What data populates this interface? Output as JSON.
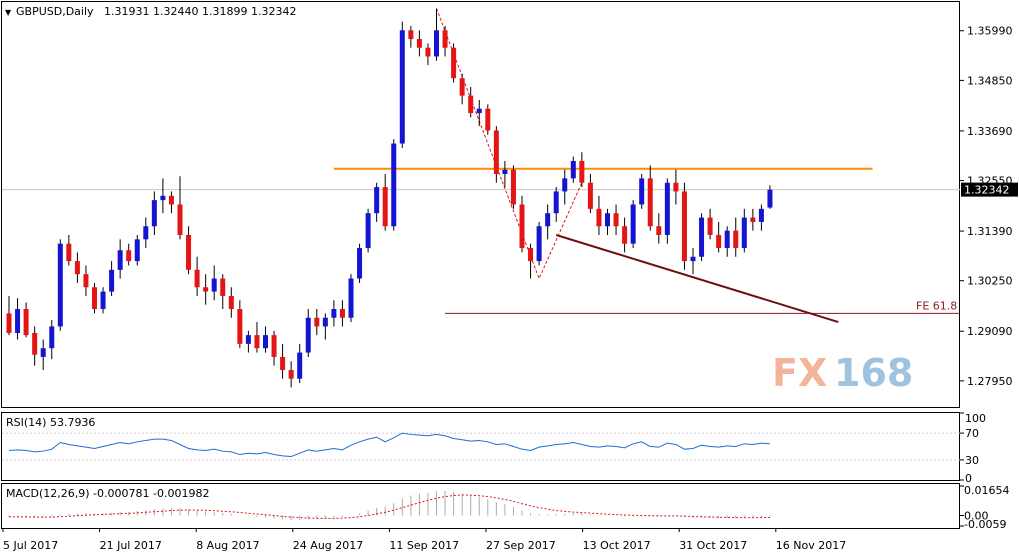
{
  "header": {
    "symbol_label": "GBPUSD,Daily",
    "ohlc_label": "1.31931 1.32440 1.31899 1.32342"
  },
  "watermark": {
    "fx": "FX",
    "num": "168",
    "fx_color": "#f3b59a",
    "num_color": "#9fc3df"
  },
  "chart_data": [
    {
      "type": "candlestick",
      "title": "",
      "y_ticks": [
        1.2795,
        1.2909,
        1.3025,
        1.3139,
        1.3255,
        1.3369,
        1.3485,
        1.3599
      ],
      "y_tick_labels": [
        "1.27950",
        "1.29090",
        "1.30250",
        "1.31390",
        "1.32550",
        "1.33690",
        "1.34850",
        "1.35990"
      ],
      "ylim": [
        1.2735,
        1.3665
      ],
      "current_price": 1.32342,
      "current_price_label": "1.32342",
      "x_labels": [
        "5 Jul 2017",
        "21 Jul 2017",
        "8 Aug 2017",
        "24 Aug 2017",
        "11 Sep 2017",
        "27 Sep 2017",
        "13 Oct 2017",
        "31 Oct 2017",
        "16 Nov 2017"
      ],
      "up_color": "#1414d2",
      "down_color": "#e51515",
      "candles_ohlc": [
        [
          1.295,
          1.299,
          1.29,
          1.2905
        ],
        [
          1.2905,
          1.2985,
          1.289,
          1.296
        ],
        [
          1.296,
          1.2975,
          1.2895,
          1.29
        ],
        [
          1.2905,
          1.292,
          1.283,
          1.2855
        ],
        [
          1.285,
          1.289,
          1.282,
          1.287
        ],
        [
          1.287,
          1.2935,
          1.2845,
          1.292
        ],
        [
          1.292,
          1.312,
          1.291,
          1.311
        ],
        [
          1.311,
          1.313,
          1.306,
          1.307
        ],
        [
          1.307,
          1.309,
          1.302,
          1.304
        ],
        [
          1.304,
          1.306,
          1.299,
          1.301
        ],
        [
          1.301,
          1.302,
          1.295,
          1.296
        ],
        [
          1.296,
          1.301,
          1.295,
          1.3
        ],
        [
          1.3,
          1.307,
          1.299,
          1.305
        ],
        [
          1.305,
          1.312,
          1.303,
          1.3095
        ],
        [
          1.3095,
          1.311,
          1.306,
          1.307
        ],
        [
          1.307,
          1.313,
          1.306,
          1.312
        ],
        [
          1.312,
          1.317,
          1.31,
          1.315
        ],
        [
          1.315,
          1.323,
          1.313,
          1.321
        ],
        [
          1.321,
          1.326,
          1.318,
          1.322
        ],
        [
          1.322,
          1.323,
          1.318,
          1.32
        ],
        [
          1.32,
          1.3265,
          1.312,
          1.313
        ],
        [
          1.313,
          1.315,
          1.304,
          1.305
        ],
        [
          1.305,
          1.308,
          1.299,
          1.301
        ],
        [
          1.301,
          1.304,
          1.297,
          1.3
        ],
        [
          1.3,
          1.306,
          1.298,
          1.303
        ],
        [
          1.303,
          1.304,
          1.296,
          1.299
        ],
        [
          1.299,
          1.301,
          1.294,
          1.296
        ],
        [
          1.296,
          1.298,
          1.287,
          1.288
        ],
        [
          1.288,
          1.291,
          1.286,
          1.29
        ],
        [
          1.29,
          1.293,
          1.286,
          1.287
        ],
        [
          1.287,
          1.292,
          1.286,
          1.29
        ],
        [
          1.29,
          1.291,
          1.283,
          1.285
        ],
        [
          1.285,
          1.288,
          1.28,
          1.282
        ],
        [
          1.282,
          1.284,
          1.278,
          1.28
        ],
        [
          1.28,
          1.288,
          1.279,
          1.286
        ],
        [
          1.286,
          1.296,
          1.285,
          1.294
        ],
        [
          1.294,
          1.296,
          1.29,
          1.292
        ],
        [
          1.292,
          1.295,
          1.289,
          1.294
        ],
        [
          1.294,
          1.298,
          1.292,
          1.296
        ],
        [
          1.296,
          1.298,
          1.292,
          1.294
        ],
        [
          1.294,
          1.304,
          1.293,
          1.303
        ],
        [
          1.303,
          1.311,
          1.302,
          1.31
        ],
        [
          1.31,
          1.319,
          1.309,
          1.318
        ],
        [
          1.318,
          1.325,
          1.316,
          1.324
        ],
        [
          1.324,
          1.327,
          1.314,
          1.315
        ],
        [
          1.315,
          1.335,
          1.314,
          1.334
        ],
        [
          1.334,
          1.362,
          1.333,
          1.36
        ],
        [
          1.36,
          1.361,
          1.356,
          1.358
        ],
        [
          1.358,
          1.36,
          1.354,
          1.356
        ],
        [
          1.356,
          1.357,
          1.352,
          1.354
        ],
        [
          1.354,
          1.365,
          1.353,
          1.36
        ],
        [
          1.36,
          1.361,
          1.354,
          1.356
        ],
        [
          1.356,
          1.357,
          1.348,
          1.349
        ],
        [
          1.349,
          1.35,
          1.343,
          1.345
        ],
        [
          1.345,
          1.347,
          1.34,
          1.341
        ],
        [
          1.341,
          1.344,
          1.338,
          1.342
        ],
        [
          1.342,
          1.343,
          1.336,
          1.337
        ],
        [
          1.337,
          1.338,
          1.325,
          1.327
        ],
        [
          1.327,
          1.33,
          1.324,
          1.328
        ],
        [
          1.328,
          1.329,
          1.319,
          1.32
        ],
        [
          1.32,
          1.322,
          1.309,
          1.31
        ],
        [
          1.31,
          1.311,
          1.303,
          1.307
        ],
        [
          1.307,
          1.316,
          1.306,
          1.315
        ],
        [
          1.315,
          1.32,
          1.312,
          1.318
        ],
        [
          1.318,
          1.324,
          1.316,
          1.323
        ],
        [
          1.323,
          1.328,
          1.32,
          1.326
        ],
        [
          1.326,
          1.331,
          1.325,
          1.33
        ],
        [
          1.33,
          1.332,
          1.324,
          1.325
        ],
        [
          1.325,
          1.327,
          1.318,
          1.319
        ],
        [
          1.319,
          1.322,
          1.313,
          1.315
        ],
        [
          1.315,
          1.319,
          1.313,
          1.318
        ],
        [
          1.318,
          1.32,
          1.313,
          1.315
        ],
        [
          1.315,
          1.317,
          1.309,
          1.311
        ],
        [
          1.311,
          1.321,
          1.31,
          1.32
        ],
        [
          1.32,
          1.327,
          1.319,
          1.326
        ],
        [
          1.326,
          1.329,
          1.314,
          1.315
        ],
        [
          1.315,
          1.318,
          1.311,
          1.313
        ],
        [
          1.313,
          1.326,
          1.311,
          1.325
        ],
        [
          1.325,
          1.328,
          1.32,
          1.323
        ],
        [
          1.323,
          1.325,
          1.305,
          1.307
        ],
        [
          1.307,
          1.31,
          1.304,
          1.308
        ],
        [
          1.308,
          1.318,
          1.307,
          1.317
        ],
        [
          1.317,
          1.319,
          1.312,
          1.313
        ],
        [
          1.313,
          1.316,
          1.309,
          1.31
        ],
        [
          1.31,
          1.315,
          1.308,
          1.314
        ],
        [
          1.314,
          1.317,
          1.308,
          1.31
        ],
        [
          1.31,
          1.319,
          1.309,
          1.317
        ],
        [
          1.317,
          1.319,
          1.314,
          1.316
        ],
        [
          1.316,
          1.32,
          1.314,
          1.319
        ],
        [
          1.3193,
          1.3244,
          1.319,
          1.3234
        ]
      ],
      "annotations": [
        {
          "type": "resistance-line",
          "price": 1.3282,
          "color": "#ff8c00"
        },
        {
          "type": "fibonacci-level",
          "label": "FE 61.8",
          "price": 1.295,
          "color": "#8b1a1a"
        },
        {
          "type": "trendline",
          "from_price": 1.313,
          "to_price": 1.293,
          "color": "#6b0f0f"
        },
        {
          "type": "zigzag",
          "points": [
            1.365,
            1.303,
            1.325
          ],
          "color": "#e51515"
        }
      ]
    },
    {
      "type": "line",
      "title": "RSI(14) 53.7936",
      "y_ticks": [
        0,
        30,
        70,
        100
      ],
      "y_tick_labels": [
        "0",
        "30",
        "70",
        "100"
      ],
      "ylim": [
        0,
        100
      ],
      "color": "#1e6fd0",
      "values": [
        44,
        45,
        44,
        42,
        43,
        46,
        56,
        53,
        51,
        49,
        47,
        50,
        53,
        56,
        54,
        57,
        59,
        61,
        61,
        59,
        53,
        47,
        45,
        44,
        46,
        43,
        42,
        38,
        40,
        39,
        41,
        38,
        36,
        35,
        40,
        45,
        43,
        45,
        47,
        45,
        52,
        57,
        61,
        64,
        57,
        63,
        70,
        68,
        67,
        66,
        68,
        66,
        62,
        60,
        58,
        59,
        57,
        53,
        54,
        50,
        46,
        44,
        49,
        51,
        53,
        54,
        56,
        53,
        50,
        49,
        51,
        50,
        48,
        54,
        57,
        50,
        49,
        55,
        53,
        46,
        47,
        52,
        50,
        49,
        51,
        50,
        54,
        53,
        55,
        54
      ]
    },
    {
      "type": "histogram+line",
      "title": "MACD(12,26,9) -0.000781 -0.001982",
      "y_ticks": [
        0.01654,
        0.0,
        -0.0059
      ],
      "y_tick_labels": [
        "0.01654",
        "0.00",
        "-0.0059"
      ],
      "ylim": [
        -0.0059,
        0.01654
      ],
      "histogram_color": "#aaaaaa",
      "signal_color": "#e51515",
      "histogram": [
        -0.001,
        -0.001,
        -0.001,
        -0.0012,
        -0.0012,
        -0.001,
        0.0005,
        0.001,
        0.0012,
        0.0012,
        0.0011,
        0.0012,
        0.0015,
        0.002,
        0.0021,
        0.0025,
        0.003,
        0.0036,
        0.0041,
        0.0043,
        0.004,
        0.0033,
        0.0027,
        0.0022,
        0.0019,
        0.0014,
        0.0009,
        0.0001,
        -0.0004,
        -0.0009,
        -0.0012,
        -0.0017,
        -0.0022,
        -0.0027,
        -0.0027,
        -0.0022,
        -0.002,
        -0.0016,
        -0.0011,
        -0.0008,
        0.0,
        0.0012,
        0.0027,
        0.0043,
        0.005,
        0.0068,
        0.0095,
        0.0112,
        0.0122,
        0.0128,
        0.0136,
        0.0138,
        0.0132,
        0.0122,
        0.0111,
        0.0102,
        0.0091,
        0.0075,
        0.0063,
        0.0047,
        0.0028,
        0.0012,
        0.0008,
        0.0006,
        0.0007,
        0.0009,
        0.0012,
        0.0011,
        0.0006,
        0.0002,
        0.0001,
        -0.0001,
        -0.0005,
        -0.0003,
        0.0002,
        -0.0001,
        -0.0004,
        0.0,
        0.0001,
        -0.0008,
        -0.0013,
        -0.0012,
        -0.0013,
        -0.0015,
        -0.0014,
        -0.0015,
        -0.0011,
        -0.0011,
        -0.0009,
        -0.0008
      ],
      "signal": [
        -0.0007,
        -0.0008,
        -0.0008,
        -0.0009,
        -0.0009,
        -0.0009,
        -0.0007,
        -0.0004,
        -0.0001,
        0.0002,
        0.0004,
        0.0006,
        0.0008,
        0.001,
        0.0012,
        0.0015,
        0.0018,
        0.0021,
        0.0024,
        0.0028,
        0.003,
        0.0031,
        0.003,
        0.0029,
        0.0027,
        0.0024,
        0.0021,
        0.0017,
        0.0012,
        0.0008,
        0.0004,
        0.0,
        -0.0005,
        -0.0009,
        -0.0012,
        -0.0014,
        -0.0016,
        -0.0016,
        -0.0016,
        -0.0015,
        -0.0012,
        -0.0007,
        0.0,
        0.0009,
        0.0018,
        0.003,
        0.0044,
        0.0058,
        0.0072,
        0.0085,
        0.0097,
        0.0106,
        0.0112,
        0.0115,
        0.0114,
        0.0111,
        0.0106,
        0.0099,
        0.009,
        0.0079,
        0.0066,
        0.0054,
        0.0044,
        0.0035,
        0.0028,
        0.0023,
        0.0019,
        0.0016,
        0.0013,
        0.001,
        0.0007,
        0.0005,
        0.0003,
        0.0001,
        0.0,
        -0.0001,
        -0.0002,
        -0.0002,
        -0.0002,
        -0.0004,
        -0.0006,
        -0.0007,
        -0.0009,
        -0.001,
        -0.0011,
        -0.0012,
        -0.0012,
        -0.0012,
        -0.0012,
        -0.0011
      ]
    }
  ]
}
